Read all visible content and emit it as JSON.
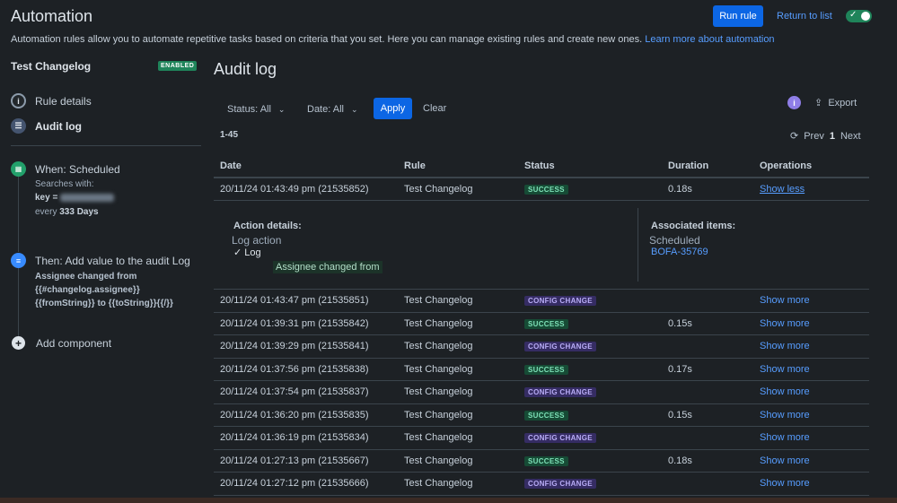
{
  "header": {
    "title": "Automation",
    "description": "Automation rules allow you to automate repetitive tasks based on criteria that you set. Here you can manage existing rules and create new ones.",
    "learn_more": "Learn more about automation",
    "run_rule": "Run rule",
    "return_to_list": "Return to list",
    "rule_enabled_toggle": true
  },
  "sidebar": {
    "rule_name": "Test Changelog",
    "status_badge": "ENABLED",
    "items": [
      {
        "label": "Rule details",
        "icon": "info-icon"
      },
      {
        "label": "Audit log",
        "icon": "audit-log-icon"
      }
    ],
    "trigger": {
      "label": "When: Scheduled",
      "searches_with": "Searches with:",
      "key_label": "key =",
      "every_prefix": "every",
      "every_value": "333 Days"
    },
    "action": {
      "label": "Then: Add value to the audit Log",
      "line1": "Assignee changed from",
      "line2": "{{#changelog.assignee}}",
      "line3": "{{fromString}} to {{toString}}{{/}}"
    },
    "add_component": "Add component"
  },
  "main": {
    "title": "Audit log",
    "status_filter": "Status: All",
    "date_filter": "Date: All",
    "apply": "Apply",
    "clear": "Clear",
    "export": "Export",
    "range": "1-45",
    "prev": "Prev",
    "page": "1",
    "next": "Next",
    "columns": [
      "Date",
      "Rule",
      "Status",
      "Duration",
      "Operations"
    ],
    "expanded": {
      "action_details": "Action details:",
      "log_action": "Log action",
      "log": "Log",
      "log_message": "Assignee changed from",
      "associated_items": "Associated items:",
      "scheduled": "Scheduled",
      "item_link": "BOFA-35769"
    },
    "rows": [
      {
        "date": "20/11/24 01:43:49 pm (21535852)",
        "rule": "Test Changelog",
        "status": "SUCCESS",
        "duration": "0.18s",
        "op": "Show less"
      },
      {
        "date": "20/11/24 01:43:47 pm (21535851)",
        "rule": "Test Changelog",
        "status": "CONFIG CHANGE",
        "duration": "",
        "op": "Show more"
      },
      {
        "date": "20/11/24 01:39:31 pm (21535842)",
        "rule": "Test Changelog",
        "status": "SUCCESS",
        "duration": "0.15s",
        "op": "Show more"
      },
      {
        "date": "20/11/24 01:39:29 pm (21535841)",
        "rule": "Test Changelog",
        "status": "CONFIG CHANGE",
        "duration": "",
        "op": "Show more"
      },
      {
        "date": "20/11/24 01:37:56 pm (21535838)",
        "rule": "Test Changelog",
        "status": "SUCCESS",
        "duration": "0.17s",
        "op": "Show more"
      },
      {
        "date": "20/11/24 01:37:54 pm (21535837)",
        "rule": "Test Changelog",
        "status": "CONFIG CHANGE",
        "duration": "",
        "op": "Show more"
      },
      {
        "date": "20/11/24 01:36:20 pm (21535835)",
        "rule": "Test Changelog",
        "status": "SUCCESS",
        "duration": "0.15s",
        "op": "Show more"
      },
      {
        "date": "20/11/24 01:36:19 pm (21535834)",
        "rule": "Test Changelog",
        "status": "CONFIG CHANGE",
        "duration": "",
        "op": "Show more"
      },
      {
        "date": "20/11/24 01:27:13 pm (21535667)",
        "rule": "Test Changelog",
        "status": "SUCCESS",
        "duration": "0.18s",
        "op": "Show more"
      },
      {
        "date": "20/11/24 01:27:12 pm (21535666)",
        "rule": "Test Changelog",
        "status": "CONFIG CHANGE",
        "duration": "",
        "op": "Show more"
      }
    ]
  }
}
